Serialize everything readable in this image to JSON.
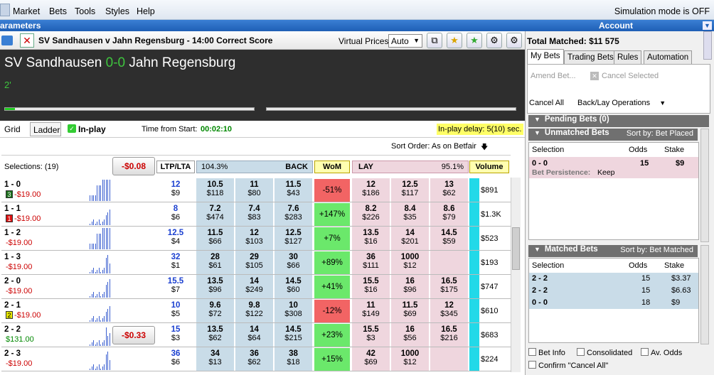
{
  "menu": {
    "items": [
      "Market",
      "Bets",
      "Tools",
      "Styles",
      "Help"
    ],
    "simulation": "Simulation mode is OFF"
  },
  "titlebar": {
    "left": "arameters",
    "right": "Account"
  },
  "toolbar": {
    "market_title": "SV Sandhausen v Jahn Regensburg - 14:00 Correct Score",
    "virtual_label": "Virtual Prices:",
    "virtual_value": "Auto"
  },
  "header": {
    "home": "SV Sandhausen",
    "score": "0-0",
    "away": "Jahn Regensburg",
    "minute": "2'"
  },
  "tabs": {
    "grid": "Grid",
    "ladder": "Ladder",
    "inplay": "In-play",
    "time_label": "Time from Start:",
    "time_value": "00:02:10",
    "delay": "In-play delay: 5(10) sec."
  },
  "sort": {
    "label": "Sort Order: As on Betfair"
  },
  "columns": {
    "selections": "Selections: (19)",
    "pl_total": "-$0.08",
    "ltp": "LTP/LTA",
    "back_pct": "104.3%",
    "back": "BACK",
    "wom": "WoM",
    "lay": "LAY",
    "lay_pct": "95.1%",
    "volume": "Volume"
  },
  "rows": [
    {
      "name": "1 - 0",
      "badge": "3",
      "badge_color": "#1a6e1a",
      "pl": "-$19.00",
      "pos": false,
      "ltp": "12",
      "lta": "$9",
      "b1": [
        "10.5",
        "$118"
      ],
      "b2": [
        "11",
        "$80"
      ],
      "b3": [
        "11.5",
        "$43"
      ],
      "wom": "-51%",
      "wom_color": "#f26464",
      "l1": [
        "12",
        "$186"
      ],
      "l2": [
        "12.5",
        "$117"
      ],
      "l3": [
        "13",
        "$62"
      ],
      "vol": "$891",
      "btn": ""
    },
    {
      "name": "1 - 1",
      "badge": "1",
      "badge_color": "#d11",
      "pl": "-$19.00",
      "pos": false,
      "ltp": "8",
      "lta": "$6",
      "b1": [
        "7.2",
        "$474"
      ],
      "b2": [
        "7.4",
        "$83"
      ],
      "b3": [
        "7.6",
        "$283"
      ],
      "wom": "+147%",
      "wom_color": "#6be86b",
      "l1": [
        "8.2",
        "$226"
      ],
      "l2": [
        "8.4",
        "$35"
      ],
      "l3": [
        "8.6",
        "$79"
      ],
      "vol": "$1.3K",
      "btn": ""
    },
    {
      "name": "1 - 2",
      "badge": "",
      "badge_color": "",
      "pl": "-$19.00",
      "pos": false,
      "ltp": "12.5",
      "lta": "$4",
      "b1": [
        "11.5",
        "$66"
      ],
      "b2": [
        "12",
        "$103"
      ],
      "b3": [
        "12.5",
        "$127"
      ],
      "wom": "+7%",
      "wom_color": "#6be86b",
      "l1": [
        "13.5",
        "$16"
      ],
      "l2": [
        "14",
        "$201"
      ],
      "l3": [
        "14.5",
        "$59"
      ],
      "vol": "$523",
      "btn": ""
    },
    {
      "name": "1 - 3",
      "badge": "",
      "badge_color": "",
      "pl": "-$19.00",
      "pos": false,
      "ltp": "32",
      "lta": "$1",
      "b1": [
        "28",
        "$61"
      ],
      "b2": [
        "29",
        "$105"
      ],
      "b3": [
        "30",
        "$66"
      ],
      "wom": "+89%",
      "wom_color": "#6be86b",
      "l1": [
        "36",
        "$111"
      ],
      "l2": [
        "1000",
        "$12"
      ],
      "l3": [
        "",
        ""
      ],
      "vol": "$193",
      "btn": ""
    },
    {
      "name": "2 - 0",
      "badge": "",
      "badge_color": "",
      "pl": "-$19.00",
      "pos": false,
      "ltp": "15.5",
      "lta": "$7",
      "b1": [
        "13.5",
        "$96"
      ],
      "b2": [
        "14",
        "$249"
      ],
      "b3": [
        "14.5",
        "$60"
      ],
      "wom": "+41%",
      "wom_color": "#6be86b",
      "l1": [
        "15.5",
        "$16"
      ],
      "l2": [
        "16",
        "$96"
      ],
      "l3": [
        "16.5",
        "$175"
      ],
      "vol": "$747",
      "btn": ""
    },
    {
      "name": "2 - 1",
      "badge": "2",
      "badge_color": "#e8e800",
      "pl": "-$19.00",
      "pos": false,
      "ltp": "10",
      "lta": "$5",
      "b1": [
        "9.6",
        "$72"
      ],
      "b2": [
        "9.8",
        "$122"
      ],
      "b3": [
        "10",
        "$308"
      ],
      "wom": "-12%",
      "wom_color": "#f26464",
      "l1": [
        "11",
        "$149"
      ],
      "l2": [
        "11.5",
        "$69"
      ],
      "l3": [
        "12",
        "$345"
      ],
      "vol": "$610",
      "btn": ""
    },
    {
      "name": "2 - 2",
      "badge": "",
      "badge_color": "",
      "pl": "$131.00",
      "pos": true,
      "ltp": "15",
      "lta": "$3",
      "b1": [
        "13.5",
        "$62"
      ],
      "b2": [
        "14",
        "$64"
      ],
      "b3": [
        "14.5",
        "$215"
      ],
      "wom": "+23%",
      "wom_color": "#6be86b",
      "l1": [
        "15.5",
        "$3"
      ],
      "l2": [
        "16",
        "$56"
      ],
      "l3": [
        "16.5",
        "$216"
      ],
      "vol": "$683",
      "btn": "-$0.33"
    },
    {
      "name": "2 - 3",
      "badge": "",
      "badge_color": "",
      "pl": "-$19.00",
      "pos": false,
      "ltp": "36",
      "lta": "$6",
      "b1": [
        "34",
        "$13"
      ],
      "b2": [
        "36",
        "$62"
      ],
      "b3": [
        "38",
        "$18"
      ],
      "wom": "+15%",
      "wom_color": "#6be86b",
      "l1": [
        "42",
        "$69"
      ],
      "l2": [
        "1000",
        "$12"
      ],
      "l3": [
        "",
        ""
      ],
      "vol": "$224",
      "btn": ""
    }
  ],
  "account": {
    "total_matched": "Total Matched: $11 575",
    "tabs": [
      "My Bets",
      "Trading Bets",
      "Rules",
      "Automation"
    ],
    "amend": "Amend Bet...",
    "cancel_selected": "Cancel Selected",
    "cancel_all": "Cancel All",
    "backlay": "Back/Lay Operations",
    "pending": "Pending Bets (0)",
    "unmatched": "Unmatched Bets",
    "unmatched_sort": "Sort by: Bet Placed",
    "matched": "Matched Bets",
    "matched_sort": "Sort by: Bet Matched",
    "col_selection": "Selection",
    "col_odds": "Odds",
    "col_stake": "Stake",
    "unmatched_rows": [
      {
        "sel": "0 - 0",
        "odds": "15",
        "stake": "$9",
        "persist_label": "Bet Persistence:",
        "persist": "Keep"
      }
    ],
    "matched_rows": [
      {
        "sel": "2 - 2",
        "odds": "15",
        "stake": "$3.37"
      },
      {
        "sel": "2 - 2",
        "odds": "15",
        "stake": "$6.63"
      },
      {
        "sel": "0 - 0",
        "odds": "18",
        "stake": "$9"
      }
    ],
    "checks": [
      "Bet Info",
      "Consolidated",
      "Av. Odds",
      "Confirm \"Cancel All\""
    ]
  }
}
